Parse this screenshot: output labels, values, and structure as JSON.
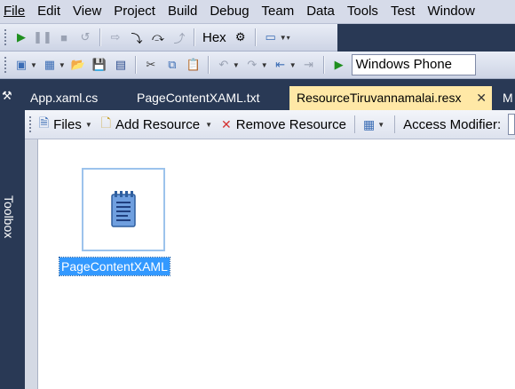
{
  "menu": [
    "File",
    "Edit",
    "View",
    "Project",
    "Build",
    "Debug",
    "Team",
    "Data",
    "Tools",
    "Test",
    "Window"
  ],
  "toolbar1": {
    "hex_label": "Hex"
  },
  "toolbar2": {
    "target_combo": "Windows Phone"
  },
  "toolbox": {
    "label": "Toolbox"
  },
  "tabs": {
    "items": [
      "App.xaml.cs",
      "PageContentXAML.txt",
      "ResourceTiruvannamalai.resx",
      "M"
    ],
    "close_glyph": "✕"
  },
  "editor_toolbar": {
    "files": "Files",
    "add_resource": "Add Resource",
    "remove_resource": "Remove Resource",
    "access_modifier": "Access Modifier:"
  },
  "resources": [
    {
      "name": "PageContentXAML",
      "icon": "text-file-icon"
    }
  ],
  "colors": {
    "chrome": "#293955",
    "active_tab": "#ffe8a6",
    "selection": "#3399ff"
  }
}
